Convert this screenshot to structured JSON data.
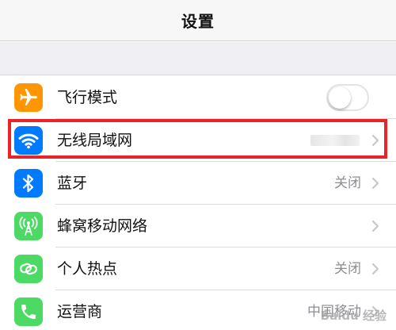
{
  "header": {
    "title": "设置"
  },
  "rows": [
    {
      "label": "飞行模式",
      "icon": "airplane-icon",
      "icon_color": "#ff9500",
      "control": "toggle",
      "toggle_on": false
    },
    {
      "label": "无线局域网",
      "icon": "wifi-icon",
      "icon_color": "#007aff",
      "value": "",
      "value_obscured": true
    },
    {
      "label": "蓝牙",
      "icon": "bluetooth-icon",
      "icon_color": "#007aff",
      "value": "关闭"
    },
    {
      "label": "蜂窝移动网络",
      "icon": "cellular-antenna-icon",
      "icon_color": "#4cd964",
      "value": ""
    },
    {
      "label": "个人热点",
      "icon": "hotspot-link-icon",
      "icon_color": "#4cd964",
      "value": "关闭"
    },
    {
      "label": "运营商",
      "icon": "phone-icon",
      "icon_color": "#4cd964",
      "value": "中国移动"
    }
  ],
  "highlight": {
    "color": "#e8232a",
    "target": "无线局域网"
  },
  "watermark": {
    "text": "Baidu 经验"
  }
}
